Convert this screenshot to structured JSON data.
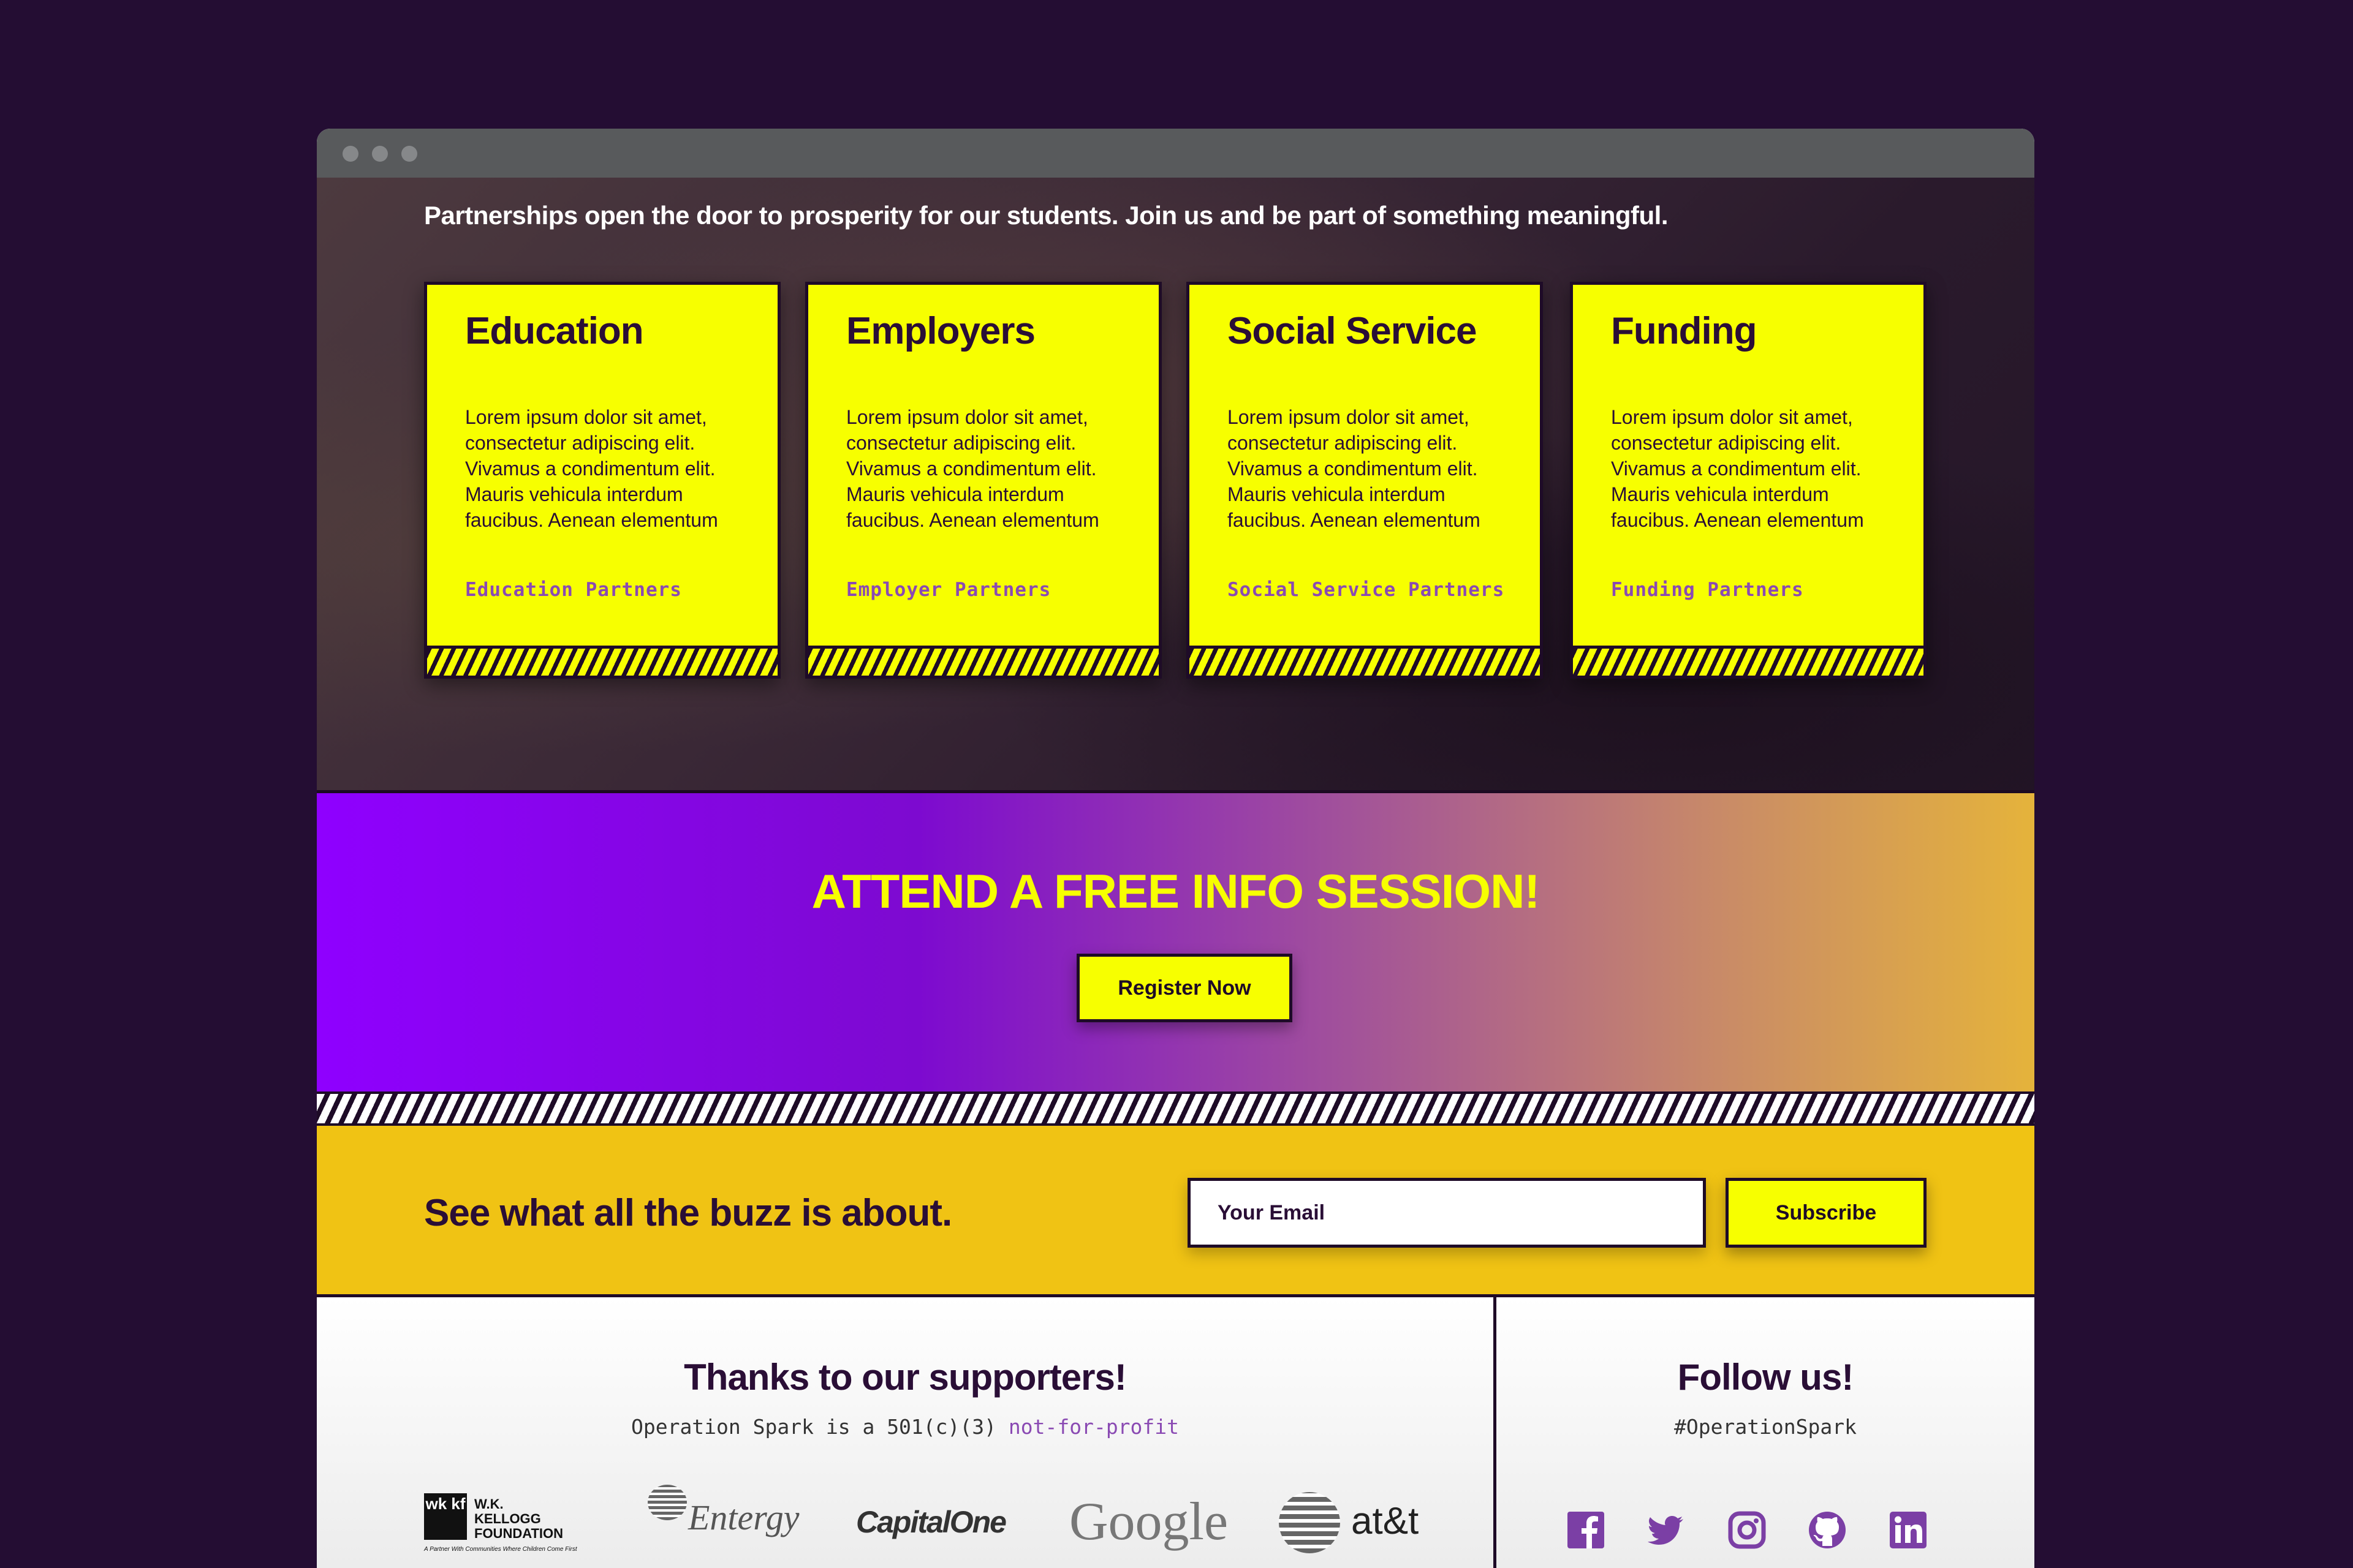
{
  "hero": {
    "intro": "Partnerships open the door to prosperity for our students. Join us and be part of something meaningful.",
    "cards": [
      {
        "title": "Education",
        "body": "Lorem ipsum dolor sit amet, consectetur adipiscing elit. Vivamus a condimentum elit. Mauris vehicula interdum faucibus. Aenean elementum",
        "link": "Education Partners"
      },
      {
        "title": "Employers",
        "body": "Lorem ipsum dolor sit amet, consectetur adipiscing elit. Vivamus a condimentum elit. Mauris vehicula interdum faucibus. Aenean elementum",
        "link": "Employer Partners"
      },
      {
        "title": "Social Service",
        "body": "Lorem ipsum dolor sit amet, consectetur adipiscing elit. Vivamus a condimentum elit. Mauris vehicula interdum faucibus. Aenean elementum",
        "link": "Social Service Partners"
      },
      {
        "title": "Funding",
        "body": "Lorem ipsum dolor sit amet, consectetur adipiscing elit. Vivamus a condimentum elit. Mauris vehicula interdum faucibus. Aenean elementum",
        "link": "Funding Partners"
      }
    ]
  },
  "cta": {
    "heading": "ATTEND A FREE INFO SESSION!",
    "button": "Register Now"
  },
  "subscribe": {
    "heading": "See what all the buzz is about.",
    "email_placeholder": "Your Email",
    "button": "Subscribe"
  },
  "footer": {
    "supporters_title": "Thanks to our supporters!",
    "supporters_sub_prefix": "Operation Spark is a 501(c)(3)",
    "supporters_sub_accent": "not-for-profit",
    "follow_title": "Follow us!",
    "follow_sub": "#OperationSpark",
    "logos": {
      "wkkf_box": "wk kf",
      "wkkf_name_1": "W.K.",
      "wkkf_name_2": "KELLOGG",
      "wkkf_name_3": "FOUNDATION",
      "wkkf_tagline": "A Partner With Communities Where Children Come First",
      "entergy": "Entergy",
      "capitalone": "CapitalOne",
      "google": "Google",
      "att": "at&t"
    },
    "social_icons": [
      "facebook-icon",
      "twitter-icon",
      "instagram-icon",
      "github-icon",
      "linkedin-icon"
    ]
  },
  "colors": {
    "page_bg": "#240d33",
    "card_yellow": "#f7ff00",
    "dark_purple": "#2a0e36",
    "link_purple": "#8a4ab3",
    "subscribe_gold": "#f0c314",
    "gradient_start": "#8f00ff",
    "gradient_end": "#e5b33b",
    "social_purple": "#7b3fa5"
  }
}
